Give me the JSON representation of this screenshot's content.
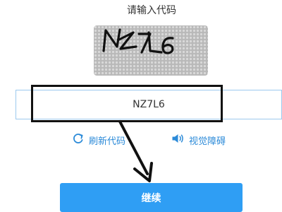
{
  "captcha": {
    "prompt": "请输入代码",
    "image_text": "NZ7L6",
    "input_value": "NZ7L6"
  },
  "links": {
    "refresh_label": "刷新代码",
    "audio_label": "视觉障碍"
  },
  "actions": {
    "continue_label": "继续"
  },
  "icons": {
    "refresh": "refresh-icon",
    "audio": "speaker-icon"
  },
  "colors": {
    "accent": "#2f9ef4",
    "link": "#2b8ad8",
    "input_border": "#9cc9ee",
    "captcha_bg": "#b9b9b9",
    "annotation": "#111111"
  }
}
